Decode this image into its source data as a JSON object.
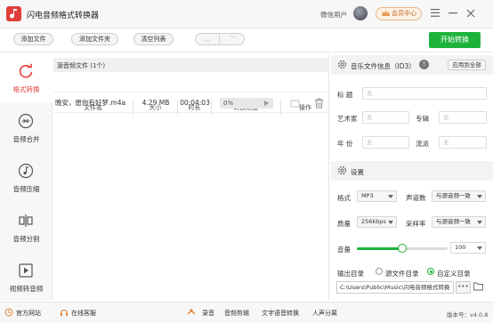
{
  "app": {
    "title": "闪电音频格式转换器",
    "user": "微信用户",
    "vip": "会员中心"
  },
  "toolbar": {
    "add_file": "添加文件",
    "add_folder": "添加文件夹",
    "clear_list": "清空列表",
    "start": "开始转换"
  },
  "sidebar": {
    "items": [
      {
        "label": "格式转换",
        "icon": "refresh-icon",
        "active": true
      },
      {
        "label": "音频合并",
        "icon": "merge-icon"
      },
      {
        "label": "音频压缩",
        "icon": "music-note-icon"
      },
      {
        "label": "音频分割",
        "icon": "split-icon"
      },
      {
        "label": "视频转音频",
        "icon": "play-icon"
      }
    ]
  },
  "filelist": {
    "header": "源音频文件 (1个)",
    "columns": [
      "文件名",
      "大小",
      "时长",
      "转换进度",
      "操作"
    ],
    "rows": [
      {
        "name": "晚安，愿你有好梦.m4a",
        "size": "4.29 MB",
        "duration": "00:04:03",
        "progress": "0%"
      }
    ]
  },
  "info": {
    "header": "音乐文件信息（ID3）",
    "apply_all": "应用到全部",
    "title_label": "标    题",
    "artist_label": "艺术家",
    "album_label": "专辑",
    "year_label": "年    份",
    "genre_label": "流派",
    "placeholder": "无"
  },
  "settings": {
    "header": "设置",
    "format_label": "格式",
    "format_value": "MP3",
    "channels_label": "声道数",
    "channels_value": "与源音频一致",
    "quality_label": "质量",
    "quality_value": "256kbps",
    "samplerate_label": "采样率",
    "samplerate_value": "与源音频一致",
    "volume_label": "音量",
    "volume_value": "100",
    "volume_fraction": 0.5,
    "output_label": "输出目录",
    "source_dir": "源文件目录",
    "custom_dir": "自定义目录",
    "path": "C:\\Users\\Public\\Music\\闪电音频格式转换",
    "more": "•••"
  },
  "statusbar": {
    "website": "官方网站",
    "support": "在线客服",
    "record": "录音",
    "cut": "音频剪辑",
    "tts": "文字语音转换",
    "vocal": "人声分离",
    "version": "版本号：v4.0.8"
  },
  "colors": {
    "accent_green": "#1db33b",
    "accent_red": "#e23e3a"
  }
}
